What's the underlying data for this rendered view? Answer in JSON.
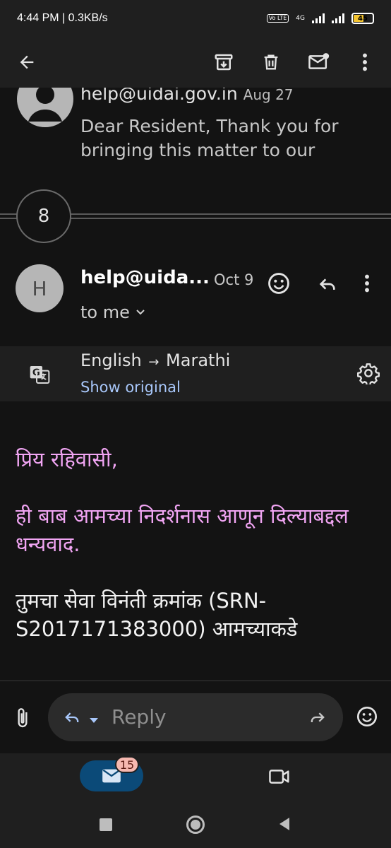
{
  "status_bar": {
    "time": "4:44 PM | 0.3KB/s",
    "volte": "Vo LTE",
    "network": "4G",
    "battery": "45"
  },
  "toolbar": {
    "icons": [
      "back-arrow-icon",
      "archive-icon",
      "delete-icon",
      "mark-unread-icon",
      "more-vert-icon"
    ]
  },
  "previous_message": {
    "from": "help@uidai.gov.in",
    "date": "Aug 27",
    "snippet": "Dear Resident, Thank you for bringing this matter to our"
  },
  "collapsed_count": "8",
  "message": {
    "avatar_letter": "H",
    "sender": "help@uida...",
    "date": "Oct 9",
    "to": "to me"
  },
  "translation": {
    "source": "English",
    "target": "Marathi",
    "show_original": "Show original"
  },
  "body": {
    "greeting": "प्रिय रहिवासी,",
    "para1": "ही बाब आमच्या निदर्शनास आणून दिल्याबद्दल धन्यवाद.",
    "para2": "तुमचा सेवा विनंती क्रमांक (SRN-S2017171383000) आमच्याकडे"
  },
  "reply": {
    "label": "Reply"
  },
  "bottom_nav": {
    "mail_badge": "15"
  },
  "colors": {
    "accent_blue": "#a8c7fa",
    "translated_text": "#f1a5f3",
    "mail_pill": "#0b4a78",
    "badge": "#f6b8b0"
  }
}
